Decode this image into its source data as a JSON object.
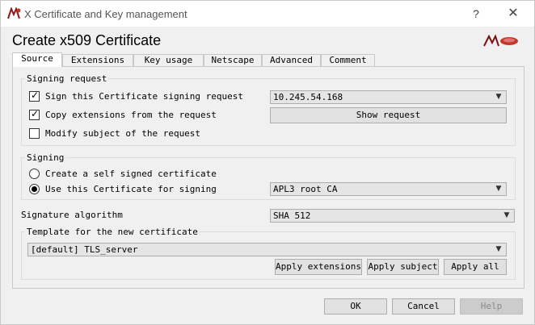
{
  "window": {
    "title": "X Certificate and Key management",
    "help_glyph": "?",
    "close_glyph": "✕"
  },
  "heading": "Create x509 Certificate",
  "tabs": [
    {
      "label": "Source",
      "active": true
    },
    {
      "label": "Extensions"
    },
    {
      "label": "Key usage"
    },
    {
      "label": "Netscape"
    },
    {
      "label": "Advanced"
    },
    {
      "label": "Comment"
    }
  ],
  "signing_request": {
    "title": "Signing request",
    "sign_csr_label": "Sign this Certificate signing request",
    "sign_csr_checked": true,
    "csr_value": "10.245.54.168",
    "copy_ext_label": "Copy extensions from the request",
    "copy_ext_checked": true,
    "show_request_label": "Show request",
    "modify_subject_label": "Modify subject of the request",
    "modify_subject_checked": false
  },
  "signing": {
    "title": "Signing",
    "self_signed_label": "Create a self signed certificate",
    "use_cert_label": "Use this Certificate for signing",
    "selected": "use_cert",
    "ca_value": "APL3 root CA"
  },
  "signature_algorithm": {
    "label": "Signature algorithm",
    "value": "SHA 512"
  },
  "template": {
    "title": "Template for the new certificate",
    "value": "[default] TLS_server",
    "apply_extensions_label": "Apply extensions",
    "apply_subject_label": "Apply subject",
    "apply_all_label": "Apply all"
  },
  "footer": {
    "ok_label": "OK",
    "cancel_label": "Cancel",
    "help_label": "Help"
  },
  "glyphs": {
    "check": "✓",
    "dropdown": "▼"
  },
  "icons": [
    "app-icon",
    "xca-logo",
    "help-icon",
    "close-icon",
    "chevron-down-icon"
  ]
}
